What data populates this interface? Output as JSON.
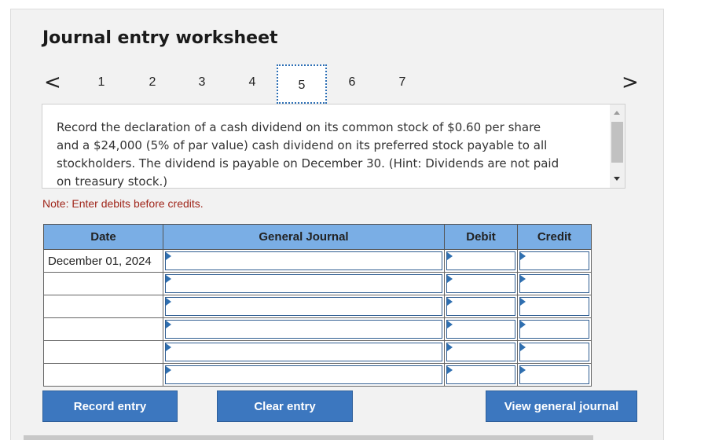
{
  "worksheet": {
    "title": "Journal entry worksheet",
    "prev_icon": "chevron-left-icon",
    "next_icon": "chevron-right-icon",
    "prev_glyph": "<",
    "next_glyph": ">",
    "steps": [
      "1",
      "2",
      "3",
      "4",
      "5",
      "6",
      "7"
    ],
    "active_step": "5"
  },
  "question": {
    "text": "Record the declaration of a cash dividend on its common stock of $0.60 per share and a $24,000 (5% of par value) cash dividend on its preferred stock payable to all stockholders. The dividend is payable on December 30. (Hint: Dividends are not paid on treasury stock.)"
  },
  "note": "Note: Enter debits before credits.",
  "journal": {
    "headers": {
      "date": "Date",
      "general_journal": "General Journal",
      "debit": "Debit",
      "credit": "Credit"
    },
    "rows": [
      {
        "date": "December 01, 2024",
        "account": "",
        "debit": "",
        "credit": ""
      },
      {
        "date": "",
        "account": "",
        "debit": "",
        "credit": ""
      },
      {
        "date": "",
        "account": "",
        "debit": "",
        "credit": ""
      },
      {
        "date": "",
        "account": "",
        "debit": "",
        "credit": ""
      },
      {
        "date": "",
        "account": "",
        "debit": "",
        "credit": ""
      },
      {
        "date": "",
        "account": "",
        "debit": "",
        "credit": ""
      }
    ]
  },
  "buttons": {
    "record": "Record entry",
    "clear": "Clear entry",
    "view": "View general journal"
  },
  "colors": {
    "header_bg": "#7aaee5",
    "button_bg": "#3c77bf",
    "note_text": "#a0261b"
  }
}
